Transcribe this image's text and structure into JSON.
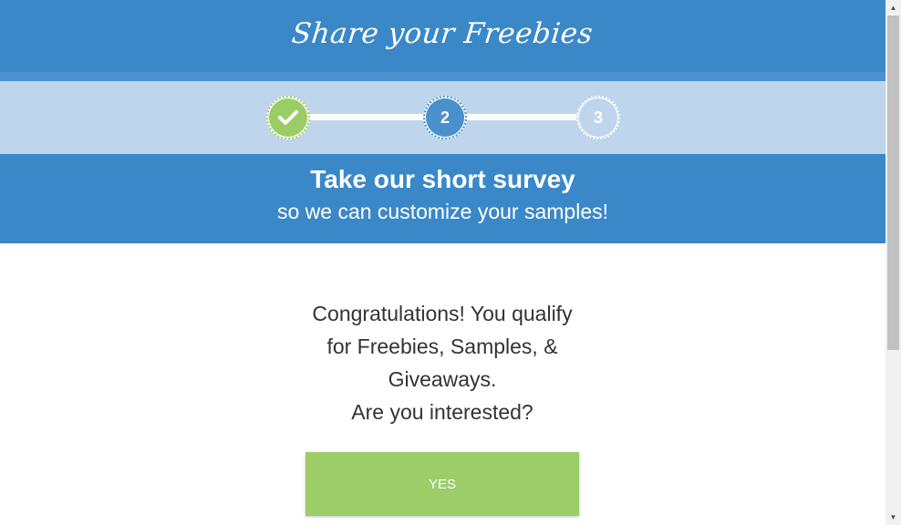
{
  "header": {
    "logo_text": "Share your Freebies"
  },
  "steps": [
    {
      "label": "✓",
      "state": "completed",
      "color": "#9ccc65"
    },
    {
      "label": "2",
      "state": "current",
      "color": "#4a90cc"
    },
    {
      "label": "3",
      "state": "upcoming",
      "color": "#bed5ec"
    }
  ],
  "title_band": {
    "title": "Take our short survey",
    "subtitle": "so we can customize your samples!"
  },
  "question": {
    "line1": "Congratulations! You qualify",
    "line2": "for Freebies, Samples, &",
    "line3": "Giveaways.",
    "line4": "Are you interested?"
  },
  "buttons": {
    "yes_label": "YES"
  },
  "colors": {
    "brand_blue": "#3a88c8",
    "light_blue": "#bed5ec",
    "green": "#9ccd69"
  }
}
